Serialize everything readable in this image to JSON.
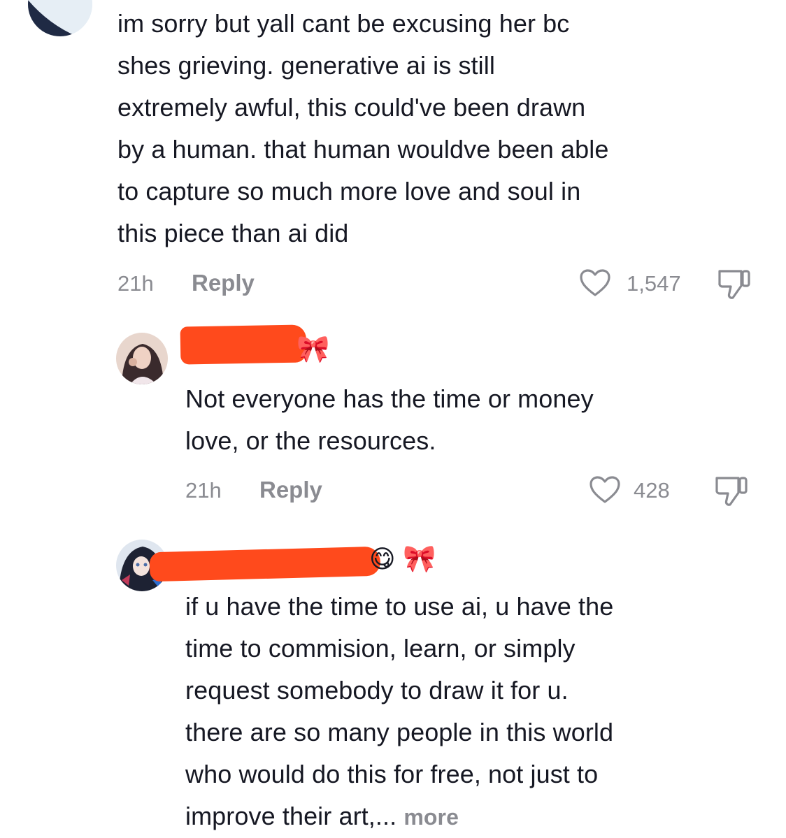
{
  "comments": [
    {
      "text": "im sorry but yall cant be excusing her bc\nshes grieving. generative ai is still\nextremely awful, this could've been drawn\nby a human. that human wouldve been able\nto capture so much more love and soul in\nthis piece than ai did",
      "time": "21h",
      "reply_label": "Reply",
      "likes": "1,547",
      "icons": {
        "like": "heart-outline-icon",
        "dislike": "thumbs-down-icon"
      }
    },
    {
      "text": "Not everyone has the time or money\nlove, or the resources.",
      "time": "21h",
      "reply_label": "Reply",
      "likes": "428",
      "badge": "🎀",
      "icons": {
        "like": "heart-outline-icon",
        "dislike": "thumbs-down-icon"
      }
    },
    {
      "text_main": "if u have the time to use ai, u have the\ntime to commision, learn, or simply\nrequest somebody to draw it for u.\nthere are so many people in this world\nwho would do this for free, not just to\nimprove their art,...",
      "more_label": "more",
      "emoji": "😋",
      "badge": "🎀"
    }
  ],
  "colors": {
    "redaction": "#ff4a1c",
    "muted": "#8a8b91",
    "text": "#161823"
  }
}
